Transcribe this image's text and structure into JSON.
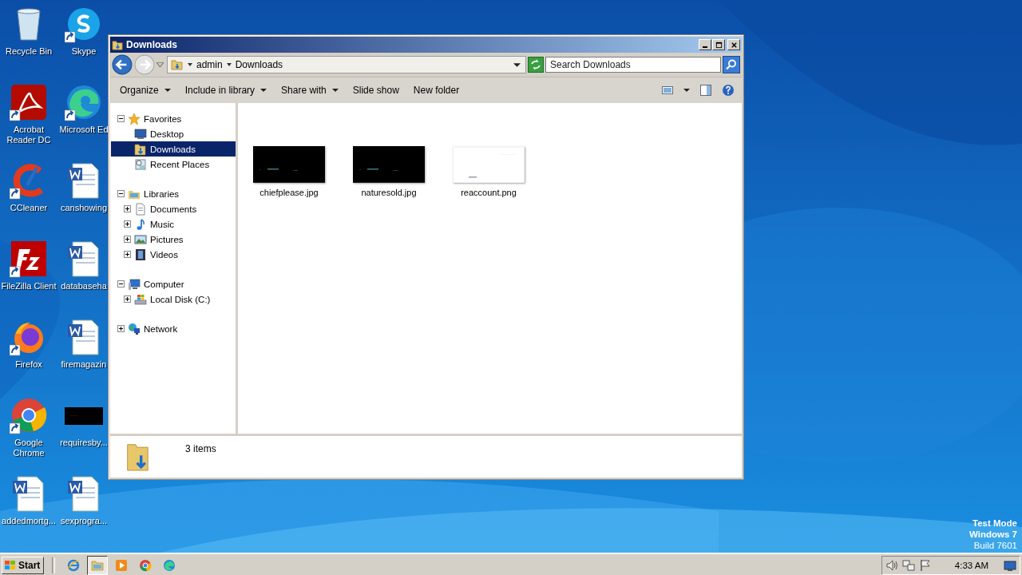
{
  "desktop_icons": [
    {
      "label": "Recycle Bin",
      "kind": "recycle",
      "shortcut": false
    },
    {
      "label": "Acrobat Reader DC",
      "kind": "acrobat",
      "shortcut": true
    },
    {
      "label": "CCleaner",
      "kind": "ccleaner",
      "shortcut": true
    },
    {
      "label": "FileZilla Client",
      "kind": "filezilla",
      "shortcut": true
    },
    {
      "label": "Firefox",
      "kind": "firefox",
      "shortcut": true
    },
    {
      "label": "Google Chrome",
      "kind": "chrome",
      "shortcut": true
    },
    {
      "label": "addedmortg...",
      "kind": "word",
      "shortcut": false
    },
    {
      "label": "Skype",
      "kind": "skype",
      "shortcut": true
    },
    {
      "label": "Microsoft Ed",
      "kind": "edge",
      "shortcut": true
    },
    {
      "label": "canshowing",
      "kind": "word",
      "shortcut": false
    },
    {
      "label": "databaseha",
      "kind": "word",
      "shortcut": false
    },
    {
      "label": "firemagazin",
      "kind": "word",
      "shortcut": false
    },
    {
      "label": "requiresby...",
      "kind": "black",
      "shortcut": false
    },
    {
      "label": "sexprogra...",
      "kind": "word",
      "shortcut": false
    }
  ],
  "window": {
    "title": "Downloads",
    "breadcrumb": [
      "admin",
      "Downloads"
    ],
    "search": {
      "placeholder": "Search Downloads"
    },
    "toolbar": [
      {
        "label": "Organize",
        "dropdown": true
      },
      {
        "label": "Include in library",
        "dropdown": true
      },
      {
        "label": "Share with",
        "dropdown": true
      },
      {
        "label": "Slide show",
        "dropdown": false
      },
      {
        "label": "New folder",
        "dropdown": false
      }
    ],
    "nav": [
      {
        "label": "Favorites",
        "kind": "star",
        "expanded": true,
        "selected": false,
        "children": [
          {
            "label": "Desktop",
            "kind": "desktop",
            "selected": false
          },
          {
            "label": "Downloads",
            "kind": "downloads",
            "selected": true
          },
          {
            "label": "Recent Places",
            "kind": "recent",
            "selected": false
          }
        ]
      },
      {
        "label": "Libraries",
        "kind": "library",
        "expanded": true,
        "selected": false,
        "children": [
          {
            "label": "Documents",
            "kind": "document",
            "expanded": false,
            "selected": false
          },
          {
            "label": "Music",
            "kind": "music",
            "expanded": false,
            "selected": false
          },
          {
            "label": "Pictures",
            "kind": "pictures",
            "expanded": false,
            "selected": false
          },
          {
            "label": "Videos",
            "kind": "videos",
            "expanded": false,
            "selected": false
          }
        ]
      },
      {
        "label": "Computer",
        "kind": "computer",
        "expanded": true,
        "selected": false,
        "children": [
          {
            "label": "Local Disk (C:)",
            "kind": "disk",
            "expanded": false,
            "selected": false
          }
        ]
      },
      {
        "label": "Network",
        "kind": "network",
        "expanded": false,
        "selected": false
      }
    ],
    "files": [
      {
        "name": "chiefplease.jpg",
        "kind": "dark"
      },
      {
        "name": "naturesold.jpg",
        "kind": "dark"
      },
      {
        "name": "reaccount.png",
        "kind": "light"
      }
    ],
    "details": {
      "count": "3 items"
    }
  },
  "taskbar": {
    "start": "Start",
    "apps": [
      {
        "kind": "ie",
        "selected": false
      },
      {
        "kind": "explorer",
        "selected": true
      },
      {
        "kind": "media",
        "selected": false
      },
      {
        "kind": "chrome",
        "selected": false
      },
      {
        "kind": "edge",
        "selected": false
      }
    ],
    "time": "4:33 AM"
  },
  "system_notice": [
    "Test Mode",
    "Windows 7",
    "Build 7601"
  ]
}
